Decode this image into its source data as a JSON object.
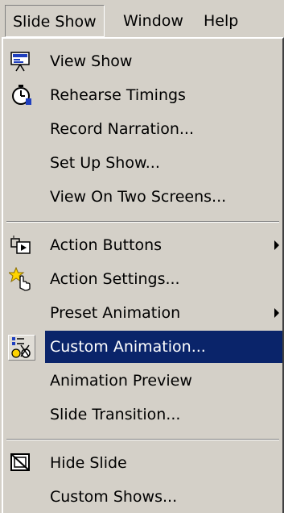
{
  "menubar": {
    "items": [
      {
        "label": "Slide Show",
        "active": true
      },
      {
        "label": "Window",
        "active": false
      },
      {
        "label": "Help",
        "active": false
      }
    ]
  },
  "menu": {
    "items": [
      {
        "label": "View Show",
        "icon": "view-show-icon"
      },
      {
        "label": "Rehearse Timings",
        "icon": "stopwatch-icon"
      },
      {
        "label": "Record Narration...",
        "icon": null
      },
      {
        "label": "Set Up Show...",
        "icon": null
      },
      {
        "label": "View On Two Screens...",
        "icon": null
      },
      {
        "label": "Action Buttons",
        "icon": "action-buttons-icon",
        "submenu": true
      },
      {
        "label": "Action Settings...",
        "icon": "action-settings-icon"
      },
      {
        "label": "Preset Animation",
        "icon": null,
        "submenu": true
      },
      {
        "label": "Custom Animation...",
        "icon": "custom-animation-icon",
        "selected": true
      },
      {
        "label": "Animation Preview",
        "icon": null
      },
      {
        "label": "Slide Transition...",
        "icon": null
      },
      {
        "label": "Hide Slide",
        "icon": "hide-slide-icon"
      },
      {
        "label": "Custom Shows...",
        "icon": null
      }
    ]
  },
  "colors": {
    "menu_bg": "#d4d0c8",
    "highlight": "#0a246a",
    "highlight_text": "#ffffff"
  }
}
